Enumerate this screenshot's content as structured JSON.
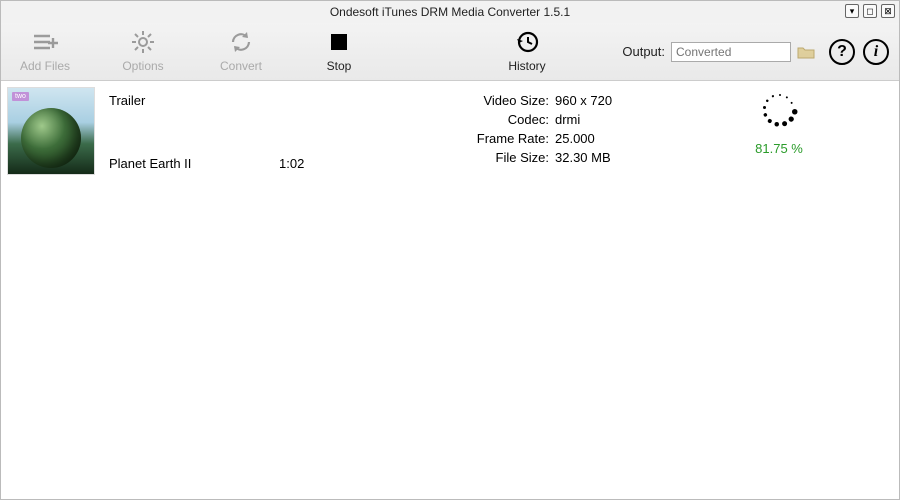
{
  "app": {
    "title": "Ondesoft iTunes DRM Media Converter 1.5.1"
  },
  "toolbar": {
    "addFiles": "Add Files",
    "options": "Options",
    "convert": "Convert",
    "stop": "Stop",
    "history": "History"
  },
  "output": {
    "label": "Output:",
    "placeholder": "Converted"
  },
  "item": {
    "title": "Trailer",
    "subtitle": "Planet Earth II",
    "duration": "1:02",
    "videoSize_k": "Video Size:",
    "videoSize_v": "960 x 720",
    "codec_k": "Codec:",
    "codec_v": "drmi",
    "frameRate_k": "Frame Rate:",
    "frameRate_v": "25.000",
    "fileSize_k": "File Size:",
    "fileSize_v": "32.30 MB",
    "progress": "81.75 %",
    "thumb_badge": "two"
  }
}
